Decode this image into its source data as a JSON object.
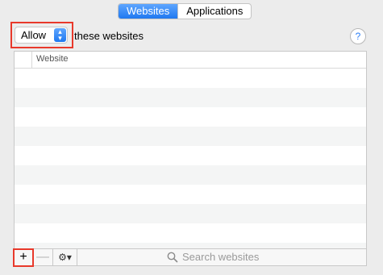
{
  "tabs": [
    {
      "label": "Websites",
      "active": true
    },
    {
      "label": "Applications",
      "active": false
    }
  ],
  "policy": {
    "selected": "Allow",
    "suffix": "these websites"
  },
  "help": {
    "label": "?"
  },
  "table": {
    "column_header": "Website",
    "rows": []
  },
  "toolbar": {
    "add_label": "+",
    "remove_label": "—",
    "action_label": "⚙▾",
    "search_placeholder": "Search websites"
  },
  "colors": {
    "accent": "#1f78f0",
    "highlight": "#e8392b"
  }
}
